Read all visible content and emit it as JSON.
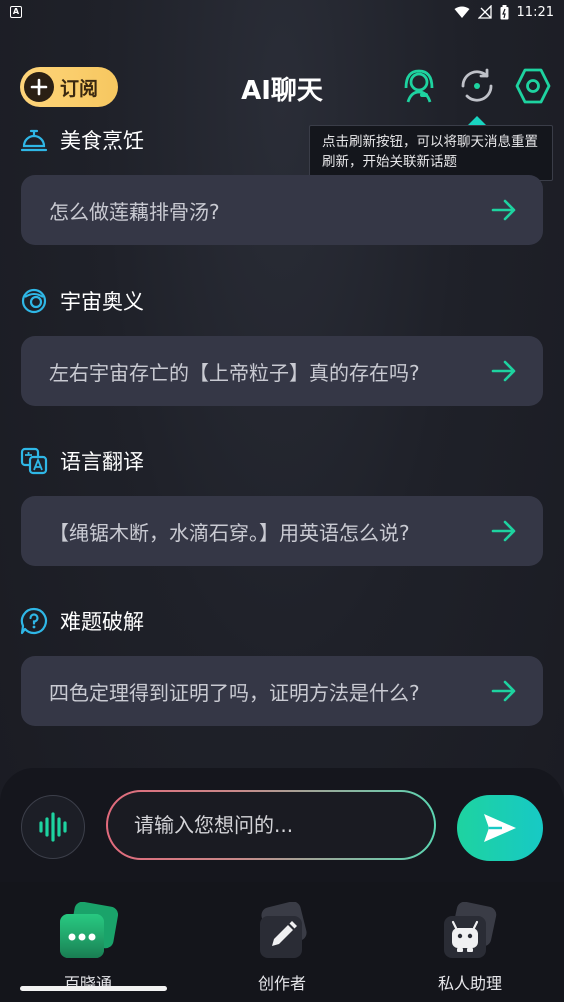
{
  "status_bar": {
    "notification_badge": "A",
    "time": "11:21"
  },
  "header": {
    "subscribe_label": "订阅",
    "title": "AI聊天",
    "icons": [
      "headset-icon",
      "refresh-icon",
      "settings-icon"
    ]
  },
  "tooltip": {
    "text": "点击刷新按钮，可以将聊天消息重置刷新，开始关联新话题"
  },
  "topics": [
    {
      "title": "美食烹饪",
      "icon": "cloche-icon",
      "question": "怎么做莲藕排骨汤?"
    },
    {
      "title": "宇宙奥义",
      "icon": "planet-icon",
      "question": "左右宇宙存亡的【上帝粒子】真的存在吗?"
    },
    {
      "title": "语言翻译",
      "icon": "translate-icon",
      "question": "【绳锯木断，水滴石穿。】用英语怎么说?"
    },
    {
      "title": "难题破解",
      "icon": "question-icon",
      "question": "四色定理得到证明了吗，证明方法是什么?"
    }
  ],
  "input": {
    "placeholder": "请输入您想问的..."
  },
  "bottom_nav": {
    "items": [
      {
        "label": "百晓通",
        "icon": "chat-bubble-icon",
        "active": true
      },
      {
        "label": "创作者",
        "icon": "pencil-icon",
        "active": false
      },
      {
        "label": "私人助理",
        "icon": "robot-icon",
        "active": false
      }
    ]
  },
  "colors": {
    "accent_green": "#1ed3a0",
    "subscribe_gold": "#f6c760",
    "card_bg": "#353746",
    "topic_icon_blue": "#2fb7e6"
  }
}
